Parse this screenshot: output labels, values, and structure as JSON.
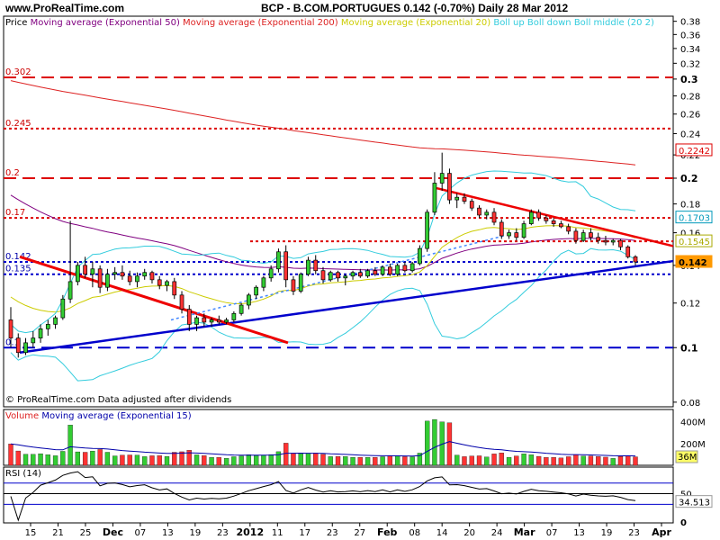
{
  "header": {
    "site": "www.ProRealTime.com",
    "title": "BCP - B.COM.PORTUGUES   0.142 (-0.70%)   Daily  28 Mar 2012"
  },
  "legend": {
    "price": "Price",
    "ma50": "Moving average (Exponential 50)",
    "ma200": "Moving average (Exponential 200)",
    "ma20": "Moving average (Exponential 20)",
    "boll_up": "Boll up",
    "boll_down": "Boll down",
    "boll_mid": "Boll middle (20 2)"
  },
  "copyright": "© ProRealTime.com  Data adjusted after dividends",
  "volume_legend": {
    "volume": "Volume",
    "ma": "Moving average (Exponential 15)"
  },
  "rsi_legend": "RSI (14)",
  "colors": {
    "up": "#33cc33",
    "down": "#ff3333",
    "ma50": "#800080",
    "ma200": "#dd2222",
    "ma20": "#cccc00",
    "boll": "#33ccdd",
    "trend_red": "#ee0000",
    "trend_blue": "#0000cc",
    "level_red": "#dd0000",
    "level_blue": "#0000cc"
  },
  "chart_data": [
    {
      "type": "candlestick",
      "title": "BCP - B.COM.PORTUGUES",
      "price_axis": {
        "min": 0.08,
        "max": 0.38,
        "ticks": [
          0.08,
          0.1,
          0.12,
          0.14,
          0.16,
          0.18,
          0.2,
          0.22,
          0.24,
          0.26,
          0.28,
          0.3,
          0.32,
          0.34,
          0.36,
          0.38
        ],
        "scale": "log"
      },
      "x_ticks": [
        "15",
        "21",
        "25",
        "Dec",
        "07",
        "13",
        "19",
        "23",
        "2012",
        "11",
        "17",
        "23",
        "27",
        "Feb",
        "08",
        "14",
        "20",
        "24",
        "Mar",
        "07",
        "13",
        "19",
        "23",
        "Apr"
      ],
      "horizontal_levels": [
        {
          "value": 0.302,
          "label": "0.302",
          "style": "dashed",
          "color": "red"
        },
        {
          "value": 0.245,
          "label": "0.245",
          "style": "dotted",
          "color": "red"
        },
        {
          "value": 0.2,
          "label": "0.2",
          "style": "dashed",
          "color": "red"
        },
        {
          "value": 0.17,
          "label": "0.17",
          "style": "dotted",
          "color": "red"
        },
        {
          "value": 0.142,
          "label": "0.142",
          "style": "dotted",
          "color": "blue"
        },
        {
          "value": 0.135,
          "label": "0.135",
          "style": "dotted",
          "color": "blue"
        },
        {
          "value": 0.1,
          "label": "0.1",
          "style": "dashed",
          "color": "blue"
        }
      ],
      "right_labels": [
        {
          "value": 0.2242,
          "label": "0.2242",
          "color": "red"
        },
        {
          "value": 0.1703,
          "label": "0.1703",
          "color": "cyan"
        },
        {
          "value": 0.1545,
          "label": "0.1545",
          "color": "yellow"
        },
        {
          "value": 0.142,
          "label": "0.142",
          "color": "orange"
        }
      ],
      "last_close": 0.142,
      "change_pct": -0.7,
      "candles": [
        [
          0.112,
          0.118,
          0.1,
          0.104
        ],
        [
          0.104,
          0.106,
          0.096,
          0.098
        ],
        [
          0.098,
          0.104,
          0.097,
          0.102
        ],
        [
          0.102,
          0.107,
          0.1,
          0.104
        ],
        [
          0.104,
          0.11,
          0.102,
          0.108
        ],
        [
          0.108,
          0.112,
          0.105,
          0.11
        ],
        [
          0.11,
          0.114,
          0.108,
          0.113
        ],
        [
          0.113,
          0.124,
          0.112,
          0.122
        ],
        [
          0.122,
          0.168,
          0.12,
          0.131
        ],
        [
          0.131,
          0.142,
          0.129,
          0.14
        ],
        [
          0.14,
          0.145,
          0.133,
          0.135
        ],
        [
          0.135,
          0.142,
          0.128,
          0.138
        ],
        [
          0.138,
          0.14,
          0.125,
          0.128
        ],
        [
          0.128,
          0.138,
          0.126,
          0.135
        ],
        [
          0.135,
          0.139,
          0.132,
          0.136
        ],
        [
          0.136,
          0.14,
          0.132,
          0.134
        ],
        [
          0.134,
          0.137,
          0.129,
          0.131
        ],
        [
          0.131,
          0.136,
          0.128,
          0.134
        ],
        [
          0.134,
          0.138,
          0.132,
          0.136
        ],
        [
          0.136,
          0.137,
          0.13,
          0.132
        ],
        [
          0.132,
          0.134,
          0.127,
          0.129
        ],
        [
          0.129,
          0.132,
          0.126,
          0.131
        ],
        [
          0.131,
          0.133,
          0.122,
          0.124
        ],
        [
          0.124,
          0.126,
          0.115,
          0.117
        ],
        [
          0.117,
          0.119,
          0.107,
          0.11
        ],
        [
          0.11,
          0.114,
          0.107,
          0.113
        ],
        [
          0.113,
          0.115,
          0.109,
          0.111
        ],
        [
          0.111,
          0.113,
          0.109,
          0.112
        ],
        [
          0.112,
          0.114,
          0.11,
          0.111
        ],
        [
          0.111,
          0.113,
          0.11,
          0.112
        ],
        [
          0.112,
          0.116,
          0.111,
          0.115
        ],
        [
          0.115,
          0.12,
          0.114,
          0.119
        ],
        [
          0.119,
          0.125,
          0.117,
          0.124
        ],
        [
          0.124,
          0.129,
          0.122,
          0.128
        ],
        [
          0.128,
          0.134,
          0.126,
          0.133
        ],
        [
          0.133,
          0.14,
          0.131,
          0.138
        ],
        [
          0.138,
          0.15,
          0.136,
          0.148
        ],
        [
          0.148,
          0.152,
          0.128,
          0.132
        ],
        [
          0.132,
          0.134,
          0.124,
          0.126
        ],
        [
          0.126,
          0.136,
          0.125,
          0.135
        ],
        [
          0.135,
          0.145,
          0.134,
          0.143
        ],
        [
          0.143,
          0.146,
          0.135,
          0.137
        ],
        [
          0.137,
          0.139,
          0.13,
          0.132
        ],
        [
          0.132,
          0.137,
          0.131,
          0.136
        ],
        [
          0.136,
          0.137,
          0.131,
          0.133
        ],
        [
          0.133,
          0.135,
          0.129,
          0.134
        ],
        [
          0.134,
          0.137,
          0.132,
          0.136
        ],
        [
          0.136,
          0.138,
          0.133,
          0.134
        ],
        [
          0.134,
          0.138,
          0.133,
          0.137
        ],
        [
          0.137,
          0.139,
          0.134,
          0.135
        ],
        [
          0.135,
          0.14,
          0.134,
          0.139
        ],
        [
          0.139,
          0.141,
          0.134,
          0.135
        ],
        [
          0.135,
          0.141,
          0.134,
          0.14
        ],
        [
          0.14,
          0.142,
          0.136,
          0.137
        ],
        [
          0.137,
          0.142,
          0.136,
          0.141
        ],
        [
          0.141,
          0.152,
          0.14,
          0.15
        ],
        [
          0.15,
          0.176,
          0.148,
          0.174
        ],
        [
          0.174,
          0.205,
          0.172,
          0.196
        ],
        [
          0.196,
          0.222,
          0.19,
          0.204
        ],
        [
          0.204,
          0.208,
          0.18,
          0.183
        ],
        [
          0.183,
          0.188,
          0.177,
          0.185
        ],
        [
          0.185,
          0.188,
          0.18,
          0.182
        ],
        [
          0.182,
          0.184,
          0.175,
          0.177
        ],
        [
          0.177,
          0.179,
          0.17,
          0.172
        ],
        [
          0.172,
          0.176,
          0.169,
          0.174
        ],
        [
          0.174,
          0.177,
          0.165,
          0.167
        ],
        [
          0.167,
          0.169,
          0.156,
          0.158
        ],
        [
          0.158,
          0.162,
          0.156,
          0.16
        ],
        [
          0.16,
          0.163,
          0.155,
          0.157
        ],
        [
          0.157,
          0.168,
          0.156,
          0.166
        ],
        [
          0.166,
          0.176,
          0.165,
          0.174
        ],
        [
          0.174,
          0.176,
          0.168,
          0.17
        ],
        [
          0.17,
          0.172,
          0.166,
          0.168
        ],
        [
          0.168,
          0.17,
          0.164,
          0.166
        ],
        [
          0.166,
          0.168,
          0.163,
          0.164
        ],
        [
          0.164,
          0.166,
          0.159,
          0.161
        ],
        [
          0.161,
          0.163,
          0.153,
          0.155
        ],
        [
          0.155,
          0.162,
          0.154,
          0.16
        ],
        [
          0.16,
          0.163,
          0.155,
          0.157
        ],
        [
          0.157,
          0.16,
          0.153,
          0.155
        ],
        [
          0.155,
          0.158,
          0.152,
          0.154
        ],
        [
          0.154,
          0.156,
          0.152,
          0.155
        ],
        [
          0.155,
          0.156,
          0.149,
          0.151
        ],
        [
          0.151,
          0.152,
          0.144,
          0.145
        ],
        [
          0.145,
          0.146,
          0.14,
          0.142
        ]
      ]
    },
    {
      "type": "bar",
      "title": "Volume",
      "y_ticks": [
        "400M",
        "200M"
      ],
      "last_value_label": "36M"
    },
    {
      "type": "line",
      "title": "RSI (14)",
      "y_ticks": [
        50,
        0
      ],
      "levels": [
        70,
        30
      ],
      "last_value": 34.513
    }
  ]
}
